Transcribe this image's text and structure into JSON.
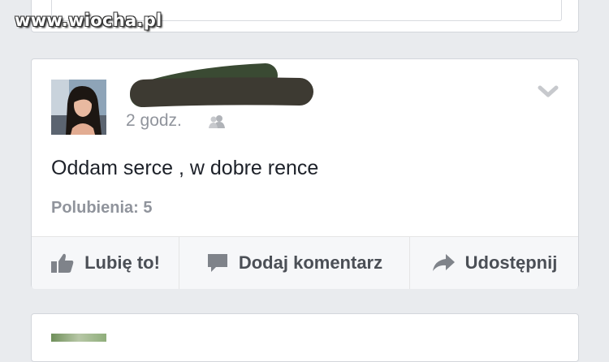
{
  "watermark": {
    "text": "www.wiocha.pl"
  },
  "post": {
    "author_name": "",
    "timestamp": "2 godz.",
    "audience_icon": "friends-icon",
    "menu_icon": "chevron-down-icon",
    "text": "Oddam serce , w dobre rence",
    "likes_label": "Polubienia: 5"
  },
  "actions": {
    "like_label": "Lubię to!",
    "comment_label": "Dodaj komentarz",
    "share_label": "Udostępnij"
  },
  "colors": {
    "page_background": "#e9ebee",
    "card_background": "#ffffff",
    "secondary_text": "#90949c",
    "action_text": "#4b4f56",
    "redaction": "#3d3a32"
  }
}
